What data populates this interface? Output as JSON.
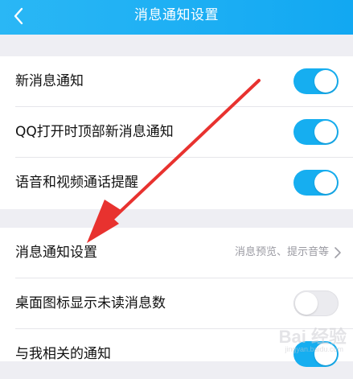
{
  "header": {
    "title": "消息通知设置",
    "background": "#1aaef3"
  },
  "group1": {
    "rows": [
      {
        "label": "新消息通知",
        "toggle": "on"
      },
      {
        "label": "QQ打开时顶部新消息通知",
        "toggle": "on"
      },
      {
        "label": "语音和视频通话提醒",
        "toggle": "on"
      }
    ]
  },
  "group2": {
    "rows": [
      {
        "label": "消息通知设置",
        "detail": "消息预览、提示音等",
        "icon": "chevron-right-icon"
      },
      {
        "label": "桌面图标显示未读消息数",
        "toggle": "off"
      },
      {
        "label": "与我相关的通知",
        "toggle": "on"
      }
    ]
  },
  "annotation": {
    "type": "red-arrow",
    "color": "#e8322f",
    "points_to": "消息通知设置"
  },
  "watermark": {
    "text": "Bai 经验",
    "sub": "jingyan.baidu.com"
  },
  "colors": {
    "accent": "#16aef0",
    "toggle_off": "#ebebef",
    "background": "#eeeef3"
  }
}
